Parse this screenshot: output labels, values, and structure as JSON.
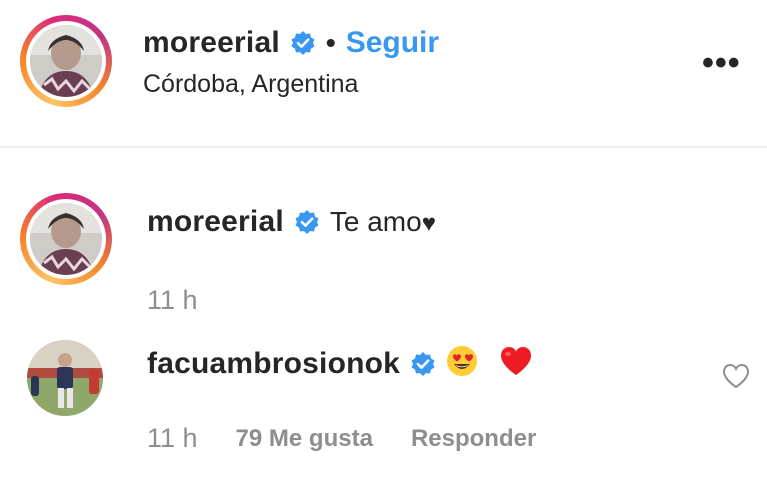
{
  "post_header": {
    "username": "moreerial",
    "separator": "•",
    "follow_label": "Seguir",
    "location": "Córdoba, Argentina",
    "more_label": "•••"
  },
  "caption": {
    "username": "moreerial",
    "text": "Te amo",
    "heart": "♥",
    "timestamp": "11 h"
  },
  "comment": {
    "username": "facuambrosionok",
    "timestamp": "11 h",
    "likes": "79 Me gusta",
    "reply_label": "Responder"
  },
  "colors": {
    "verified_blue": "#3897f0",
    "follow_blue": "#3897f0",
    "meta_gray": "#8e8e8e",
    "heart_red": "#ed1c24"
  },
  "icons": [
    "verified-icon",
    "more-options-icon",
    "like-heart-icon",
    "heart-eyes-emoji",
    "red-heart-emoji"
  ]
}
